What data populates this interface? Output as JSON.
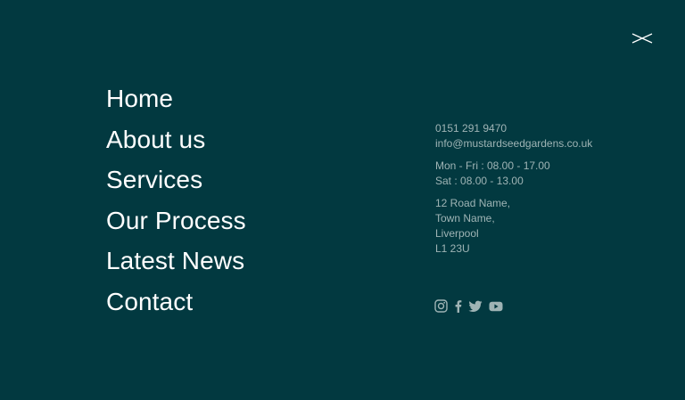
{
  "colors": {
    "background": "#023940",
    "nav_text": "#ffffff",
    "info_text": "#9fb4b5"
  },
  "close_icon": "close-icon",
  "nav": {
    "items": [
      {
        "label": "Home"
      },
      {
        "label": "About us"
      },
      {
        "label": "Services"
      },
      {
        "label": "Our Process"
      },
      {
        "label": "Latest News"
      },
      {
        "label": "Contact"
      }
    ]
  },
  "contact": {
    "phone": "0151 291 9470",
    "email": "info@mustardseedgardens.co.uk",
    "hours": [
      "Mon - Fri : 08.00 - 17.00",
      "Sat : 08.00 - 13.00"
    ],
    "address": [
      "12 Road Name,",
      "Town Name,",
      "Liverpool",
      "L1 23U"
    ]
  },
  "social": {
    "icons": [
      "instagram-icon",
      "facebook-icon",
      "twitter-icon",
      "youtube-icon"
    ]
  }
}
